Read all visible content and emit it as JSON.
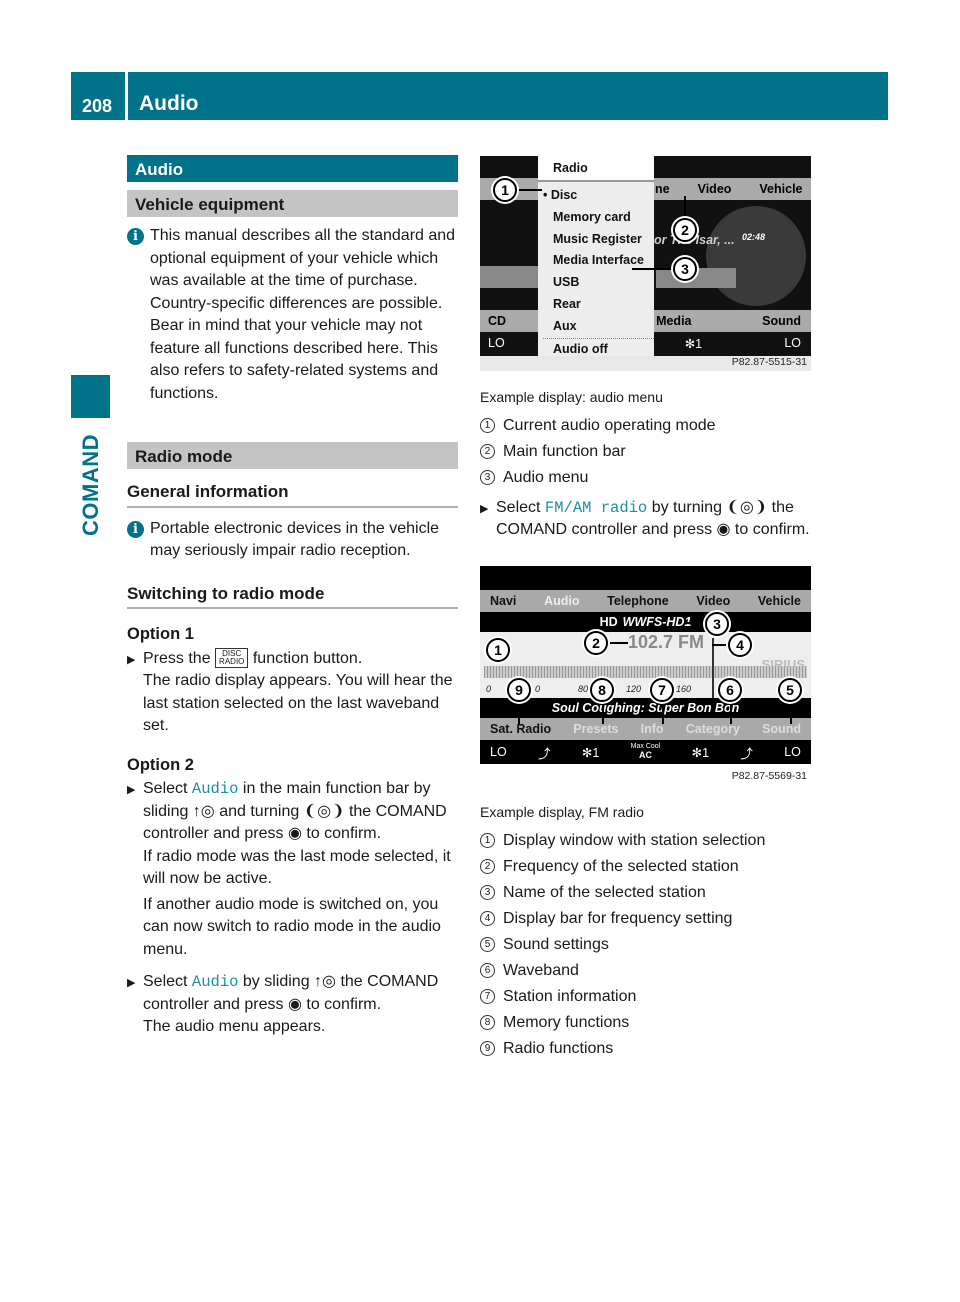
{
  "header": {
    "page_number": "208",
    "title": "Audio"
  },
  "side_tab": {
    "label": "COMAND"
  },
  "left": {
    "section_title": "Audio",
    "vehicle_equipment": {
      "title": "Vehicle equipment",
      "info_text": "This manual describes all the standard and optional equipment of your vehicle which was available at the time of purchase. Country-specific differences are possible. Bear in mind that your vehicle may not feature all functions described here. This also refers to safety-related systems and functions."
    },
    "radio_mode": {
      "title": "Radio mode"
    },
    "general_info": {
      "title": "General information",
      "info_text": "Portable electronic devices in the vehicle may seriously impair radio reception."
    },
    "switching": {
      "title": "Switching to radio mode"
    },
    "option1": {
      "title": "Option 1",
      "step_pre": "Press the",
      "button_top": "DISC",
      "button_bottom": "RADIO",
      "step_post": "function button.",
      "result": "The radio display appears. You will hear the last station selected on the last waveband set."
    },
    "option2": {
      "title": "Option 2",
      "step1_pre": "Select",
      "step1_hl": "Audio",
      "step1_post": "in the main function bar by sliding ↑◎ and turning ❨◎❩ the COMAND controller and press ◉ to confirm.",
      "result1": "If radio mode was the last mode selected, it will now be active.",
      "result2": "If another audio mode is switched on, you can now switch to radio mode in the audio menu.",
      "step2_pre": "Select",
      "step2_hl": "Audio",
      "step2_post": "by sliding ↑◎ the COMAND controller and press ◉ to confirm.",
      "result3": "The audio menu appears."
    }
  },
  "right": {
    "fig1": {
      "menu_title": "Radio",
      "menu_items": [
        "• Disc",
        "Memory card",
        "Music Register",
        "Media Interface",
        "USB",
        "Rear",
        "Aux",
        "Audio off"
      ],
      "bg_top": [
        "ne",
        "Video",
        "Vehicle"
      ],
      "track": "or The Isar, ...",
      "time": "02:48",
      "left_items": [
        "CD",
        "LO"
      ],
      "bottom_row": [
        "Media",
        "Sound"
      ],
      "climate": [
        "✻1",
        "LO"
      ],
      "code": "P82.87-5515-31",
      "callouts": [
        "1",
        "2",
        "3"
      ],
      "caption": "Example display: audio menu",
      "legend": [
        {
          "n": "1",
          "t": "Current audio operating mode"
        },
        {
          "n": "2",
          "t": "Main function bar"
        },
        {
          "n": "3",
          "t": "Audio menu"
        }
      ]
    },
    "step": {
      "pre": "Select",
      "hl": "FM/AM radio",
      "post": "by turning ❨◎❩ the COMAND controller and press ◉ to confirm."
    },
    "fig2": {
      "tabs": [
        "Navi",
        "Audio",
        "Telephone",
        "Video",
        "Vehicle"
      ],
      "station": "WWFS-HD1",
      "frequency": "102.7 FM",
      "brand": "SIRIUS",
      "scale": [
        "0",
        "0",
        "80",
        "120",
        "160",
        ":"
      ],
      "info": "Soul Coughing: Super Bon Bon",
      "func": [
        "Sat. Radio",
        "Presets",
        "Info",
        "Category",
        "Sound"
      ],
      "climate": [
        "LO",
        "✻1",
        "Max Cool",
        "AC",
        "✻1",
        "LO"
      ],
      "code": "P82.87-5569-31",
      "callouts": [
        "1",
        "2",
        "3",
        "4",
        "5",
        "6",
        "7",
        "8",
        "9"
      ],
      "caption": "Example display, FM radio",
      "legend": [
        {
          "n": "1",
          "t": "Display window with station selection"
        },
        {
          "n": "2",
          "t": "Frequency of the selected station"
        },
        {
          "n": "3",
          "t": "Name of the selected station"
        },
        {
          "n": "4",
          "t": "Display bar for frequency setting"
        },
        {
          "n": "5",
          "t": "Sound settings"
        },
        {
          "n": "6",
          "t": "Waveband"
        },
        {
          "n": "7",
          "t": "Station information"
        },
        {
          "n": "8",
          "t": "Memory functions"
        },
        {
          "n": "9",
          "t": "Radio functions"
        }
      ]
    }
  }
}
